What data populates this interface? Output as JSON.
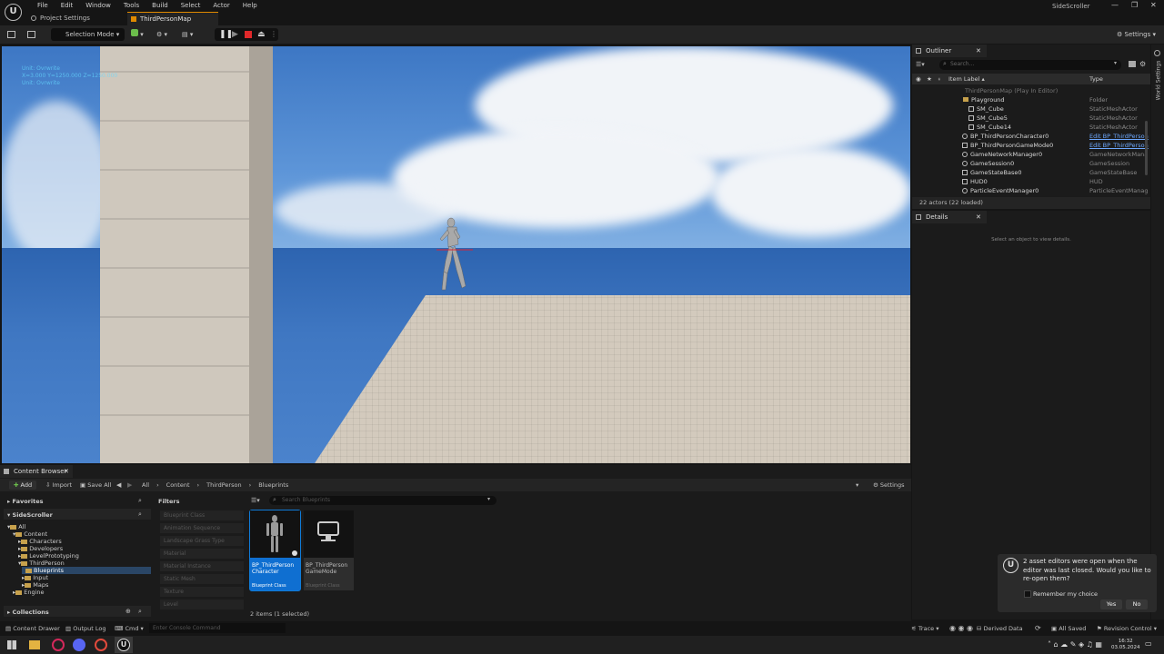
{
  "app": {
    "logo_text": "U",
    "menu": [
      "File",
      "Edit",
      "Window",
      "Tools",
      "Build",
      "Select",
      "Actor",
      "Help"
    ],
    "project_name": "SideScroller",
    "tabs": [
      "Project Settings",
      "ThirdPersonMap"
    ]
  },
  "toolbar": {
    "selection_mode": "Selection Mode",
    "settings": "Settings"
  },
  "viewport": {
    "stats": [
      "Unit: Ovrwrite",
      "X=3.000 Y=1250.000 Z=1250.000",
      "Unit: Ovrwrite"
    ]
  },
  "outliner": {
    "tab": "Outliner",
    "search_placeholder": "Search...",
    "col_label": "Item Label ▴",
    "col_type": "Type",
    "items": [
      {
        "label": "ThirdPersonMap (Play In Editor)",
        "type": ""
      },
      {
        "label": "Playground",
        "type": "Folder"
      },
      {
        "label": "SM_Cube",
        "type": "StaticMeshActor"
      },
      {
        "label": "SM_Cube5",
        "type": "StaticMeshActor"
      },
      {
        "label": "SM_Cube14",
        "type": "StaticMeshActor"
      },
      {
        "label": "BP_ThirdPersonCharacter0",
        "type": "Edit BP_ThirdPerson"
      },
      {
        "label": "BP_ThirdPersonGameMode0",
        "type": "Edit BP_ThirdPerson"
      },
      {
        "label": "GameNetworkManager0",
        "type": "GameNetworkMana"
      },
      {
        "label": "GameSession0",
        "type": "GameSession"
      },
      {
        "label": "GameStateBase0",
        "type": "GameStateBase"
      },
      {
        "label": "HUD0",
        "type": "HUD"
      },
      {
        "label": "ParticleEventManager0",
        "type": "ParticleEventManag"
      }
    ],
    "count": "22 actors (22 loaded)"
  },
  "details": {
    "tab": "Details",
    "empty": "Select an object to view details."
  },
  "side": {
    "world_settings": "World Settings"
  },
  "content_browser": {
    "tab": "Content Browser",
    "add": "Add",
    "import": "Import",
    "save_all": "Save All",
    "path": [
      "All",
      "Content",
      "ThirdPerson",
      "Blueprints"
    ],
    "settings": "Settings",
    "favorites": "Favorites",
    "project": "SideScroller",
    "tree": [
      "All",
      "Content",
      "Characters",
      "Developers",
      "LevelPrototyping",
      "ThirdPerson",
      "Blueprints",
      "Input",
      "Maps",
      "Engine"
    ],
    "collections": "Collections",
    "filters_title": "Filters",
    "filters": [
      "Blueprint Class",
      "Animation Sequence",
      "Landscape Grass Type",
      "Material",
      "Material Instance",
      "Static Mesh",
      "Texture",
      "Level"
    ],
    "search_placeholder": "Search Blueprints",
    "assets": [
      {
        "line1": "BP_ThirdPerson",
        "line2": "Character",
        "cls": "Blueprint Class"
      },
      {
        "line1": "BP_ThirdPerson",
        "line2": "GameMode",
        "cls": "Blueprint Class"
      }
    ],
    "summary": "2 items (1 selected)"
  },
  "notification": {
    "message": "2 asset editors were open when the editor was last closed. Would you like to re-open them?",
    "remember": "Remember my choice",
    "yes": "Yes",
    "no": "No"
  },
  "statusbar": {
    "content_drawer": "Content Drawer",
    "output_log": "Output Log",
    "cmd": "Cmd",
    "console_placeholder": "Enter Console Command",
    "trace": "Trace",
    "derived_data": "Derived Data",
    "all_saved": "All Saved",
    "revision_control": "Revision Control"
  },
  "taskbar": {
    "time": "16:32",
    "date": "03.05.2024"
  },
  "colors": {
    "accent": "#0f6fd1",
    "folder": "#c7a14c",
    "panel": "#1b1b1b"
  }
}
